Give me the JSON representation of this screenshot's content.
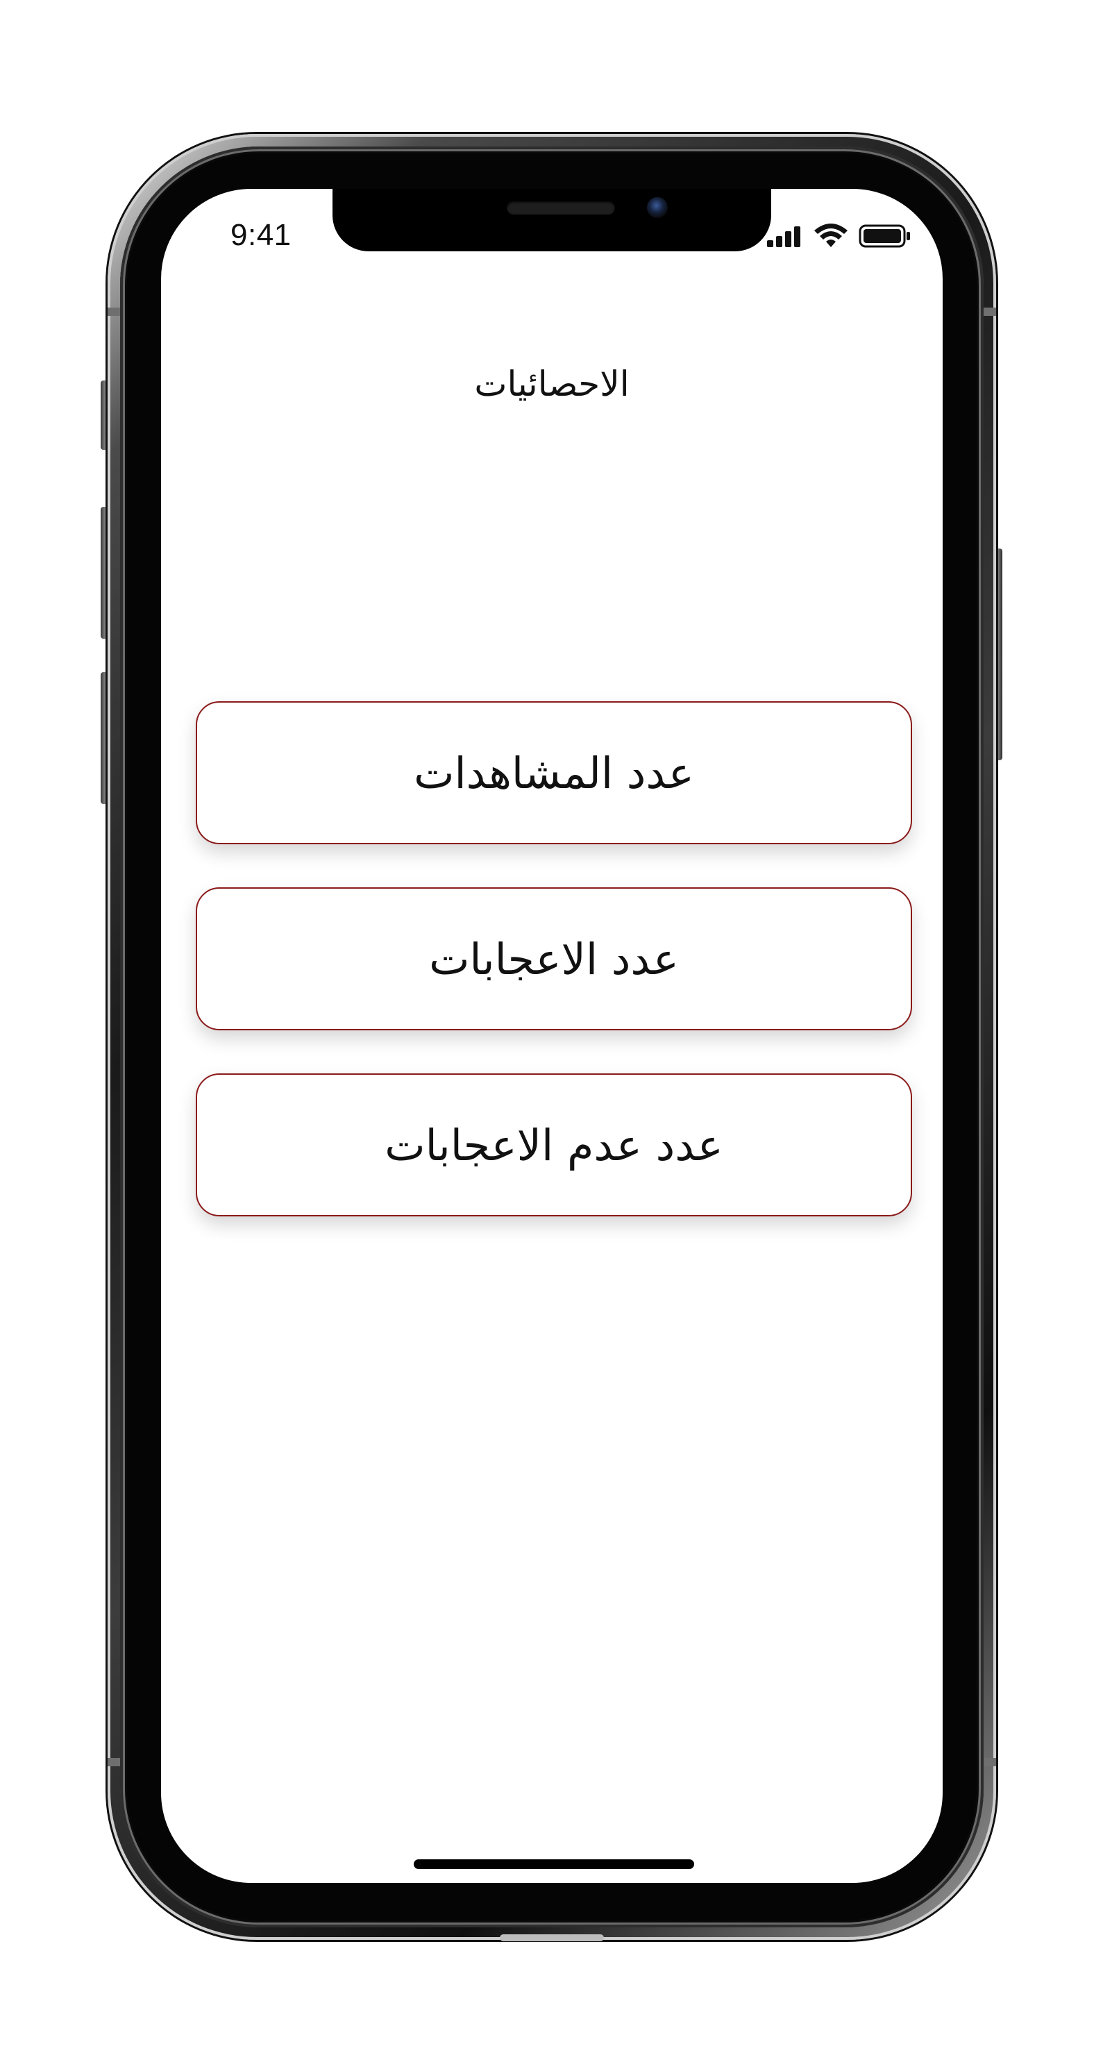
{
  "status_bar": {
    "time": "9:41",
    "icons": [
      "cellular-signal-icon",
      "wifi-icon",
      "battery-icon"
    ]
  },
  "header": {
    "title": "الاحصائيات"
  },
  "options": [
    {
      "label": "عدد المشاهدات"
    },
    {
      "label": "عدد الاعجابات"
    },
    {
      "label": "عدد عدم الاعجابات"
    }
  ],
  "colors": {
    "button_border": "#8b1a1a",
    "background": "#ffffff",
    "text": "#111111"
  }
}
